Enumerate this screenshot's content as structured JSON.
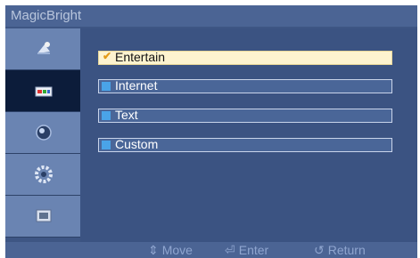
{
  "title": "MagicBright",
  "sidebar": {
    "items": [
      {
        "icon": "picture-icon",
        "active": false
      },
      {
        "icon": "color-icon",
        "active": true
      },
      {
        "icon": "image-icon",
        "active": false
      },
      {
        "icon": "setup-icon",
        "active": false
      },
      {
        "icon": "information-icon",
        "active": false
      }
    ]
  },
  "options": [
    {
      "label": "Entertain",
      "selected": true
    },
    {
      "label": "Internet",
      "selected": false
    },
    {
      "label": "Text",
      "selected": false
    },
    {
      "label": "Custom",
      "selected": false
    }
  ],
  "check_mark": "✔",
  "footer": {
    "move_icon": "⇕",
    "move_label": "Move",
    "enter_icon": "⏎",
    "enter_label": "Enter",
    "return_icon": "↺",
    "return_label": "Return"
  },
  "colors": {
    "accent": "#4aa4e8",
    "selected_bg": "#fdf3cf",
    "panel": "#3b5382"
  }
}
